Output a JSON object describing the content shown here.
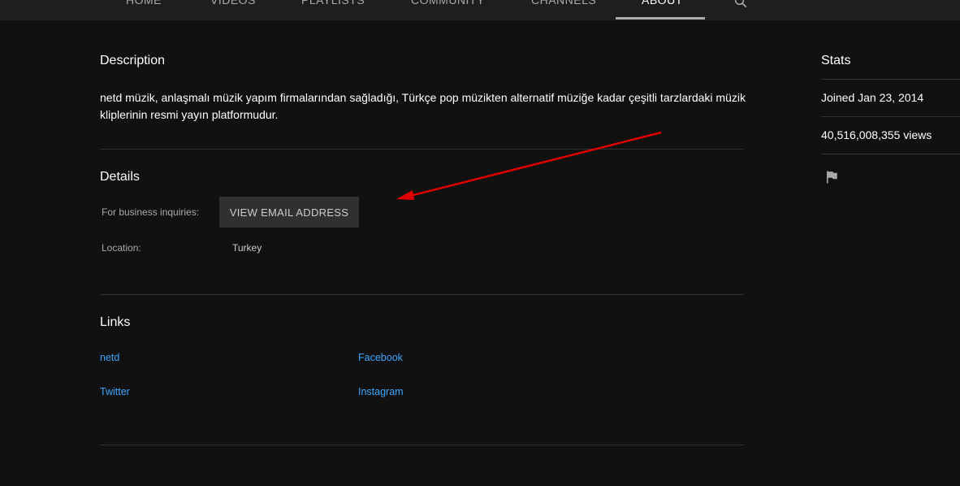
{
  "tabs": [
    {
      "label": "HOME"
    },
    {
      "label": "VIDEOS"
    },
    {
      "label": "PLAYLISTS"
    },
    {
      "label": "COMMUNITY"
    },
    {
      "label": "CHANNELS"
    },
    {
      "label": "ABOUT"
    }
  ],
  "active_tab": "ABOUT",
  "description": {
    "heading": "Description",
    "text": "netd müzik, anlaşmalı müzik yapım firmalarından sağladığı, Türkçe pop müzikten alternatif müziğe kadar çeşitli tarzlardaki müzik kliplerinin resmi yayın platformudur."
  },
  "details": {
    "heading": "Details",
    "business_label": "For business inquiries:",
    "email_button": "VIEW EMAIL ADDRESS",
    "location_label": "Location:",
    "location_value": "Turkey"
  },
  "links": {
    "heading": "Links",
    "items": [
      {
        "label": "netd"
      },
      {
        "label": "Facebook"
      },
      {
        "label": "Twitter"
      },
      {
        "label": "Instagram"
      }
    ]
  },
  "stats": {
    "heading": "Stats",
    "joined": "Joined Jan 23, 2014",
    "views": "40,516,008,355 views"
  },
  "icons": {
    "search": "search-icon",
    "flag": "flag-icon"
  },
  "colors": {
    "background": "#111111",
    "link": "#3ea6ff",
    "annotation_arrow": "#e00000"
  }
}
